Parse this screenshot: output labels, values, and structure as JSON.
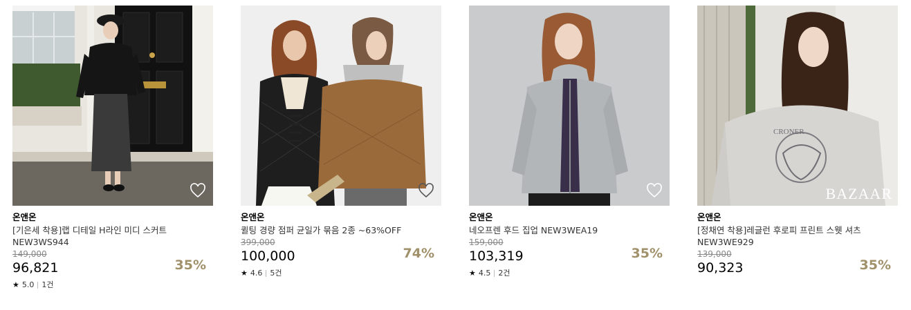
{
  "products": [
    {
      "brand": "온앤온",
      "name": "[기은세 착용]랩 디테일 H라인 미디 스커트 NEW3WS944",
      "original_price": "149,000",
      "price": "96,821",
      "discount": "35%",
      "rating": "5.0",
      "reviews": "1건"
    },
    {
      "brand": "온앤온",
      "name": "퀼팅 경량 점퍼 균일가 묶음 2종 ~63%OFF",
      "original_price": "399,000",
      "price": "100,000",
      "discount": "74%",
      "rating": "4.6",
      "reviews": "5건"
    },
    {
      "brand": "온앤온",
      "name": "네오프렌 후드 집업 NEW3WEA19",
      "original_price": "159,000",
      "price": "103,319",
      "discount": "35%",
      "rating": "4.5",
      "reviews": "2건"
    },
    {
      "brand": "온앤온",
      "name": "[정채연 착용]레글런 후로피 프린트 스웻 셔츠 NEW3WE929",
      "original_price": "139,000",
      "price": "90,323",
      "discount": "35%"
    }
  ],
  "image_logo_text": "BAZAAR",
  "icons": {
    "wishlist": "heart-outline-icon",
    "rating": "star-icon"
  },
  "colors": {
    "discount": "#a0916b",
    "original_price": "#888888"
  }
}
